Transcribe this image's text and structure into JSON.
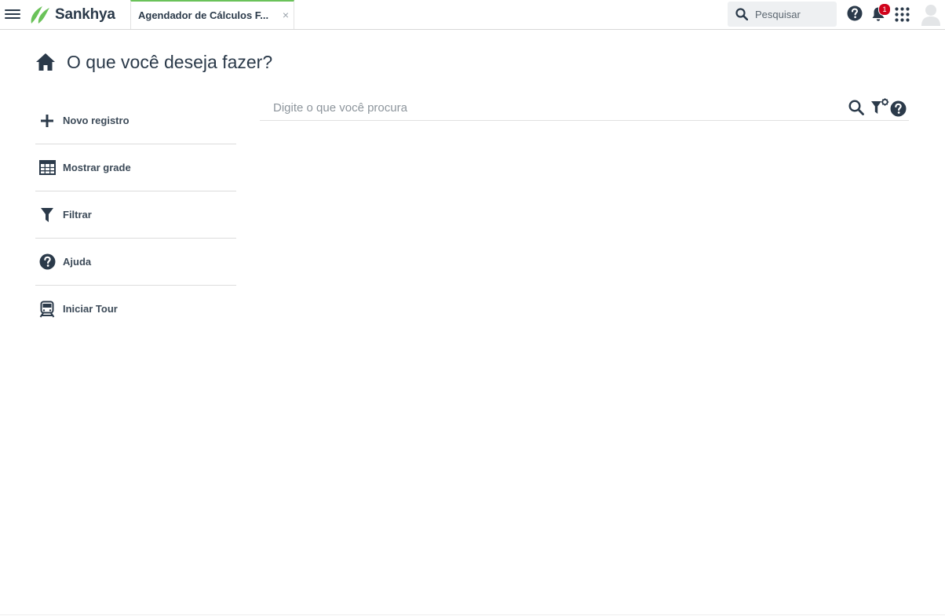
{
  "header": {
    "menu_icon": "hamburger-menu-icon",
    "brand": "Sankhya",
    "brand_color": "#6ac259",
    "tab": {
      "label": "Agendador de Cálculos F...",
      "close": "×"
    },
    "search": {
      "placeholder": "Pesquisar"
    },
    "notifications_count": "1",
    "icons": [
      "help-icon",
      "bell-icon",
      "apps-grid-icon",
      "user-avatar-icon"
    ]
  },
  "page": {
    "title": "O que você deseja fazer?"
  },
  "actions": [
    {
      "label": "Novo registro",
      "icon": "plus-icon"
    },
    {
      "label": "Mostrar grade",
      "icon": "grid-table-icon"
    },
    {
      "label": "Filtrar",
      "icon": "filter-icon"
    },
    {
      "label": "Ajuda",
      "icon": "help-circle-icon"
    },
    {
      "label": "Iniciar Tour",
      "icon": "train-icon"
    }
  ],
  "main_search": {
    "placeholder": "Digite o que você procura",
    "icons": [
      "search-icon",
      "filter-settings-icon",
      "help-circle-icon"
    ]
  },
  "colors": {
    "text": "#2b3a4a",
    "accent": "#6ac259",
    "badge": "#d0021b"
  }
}
